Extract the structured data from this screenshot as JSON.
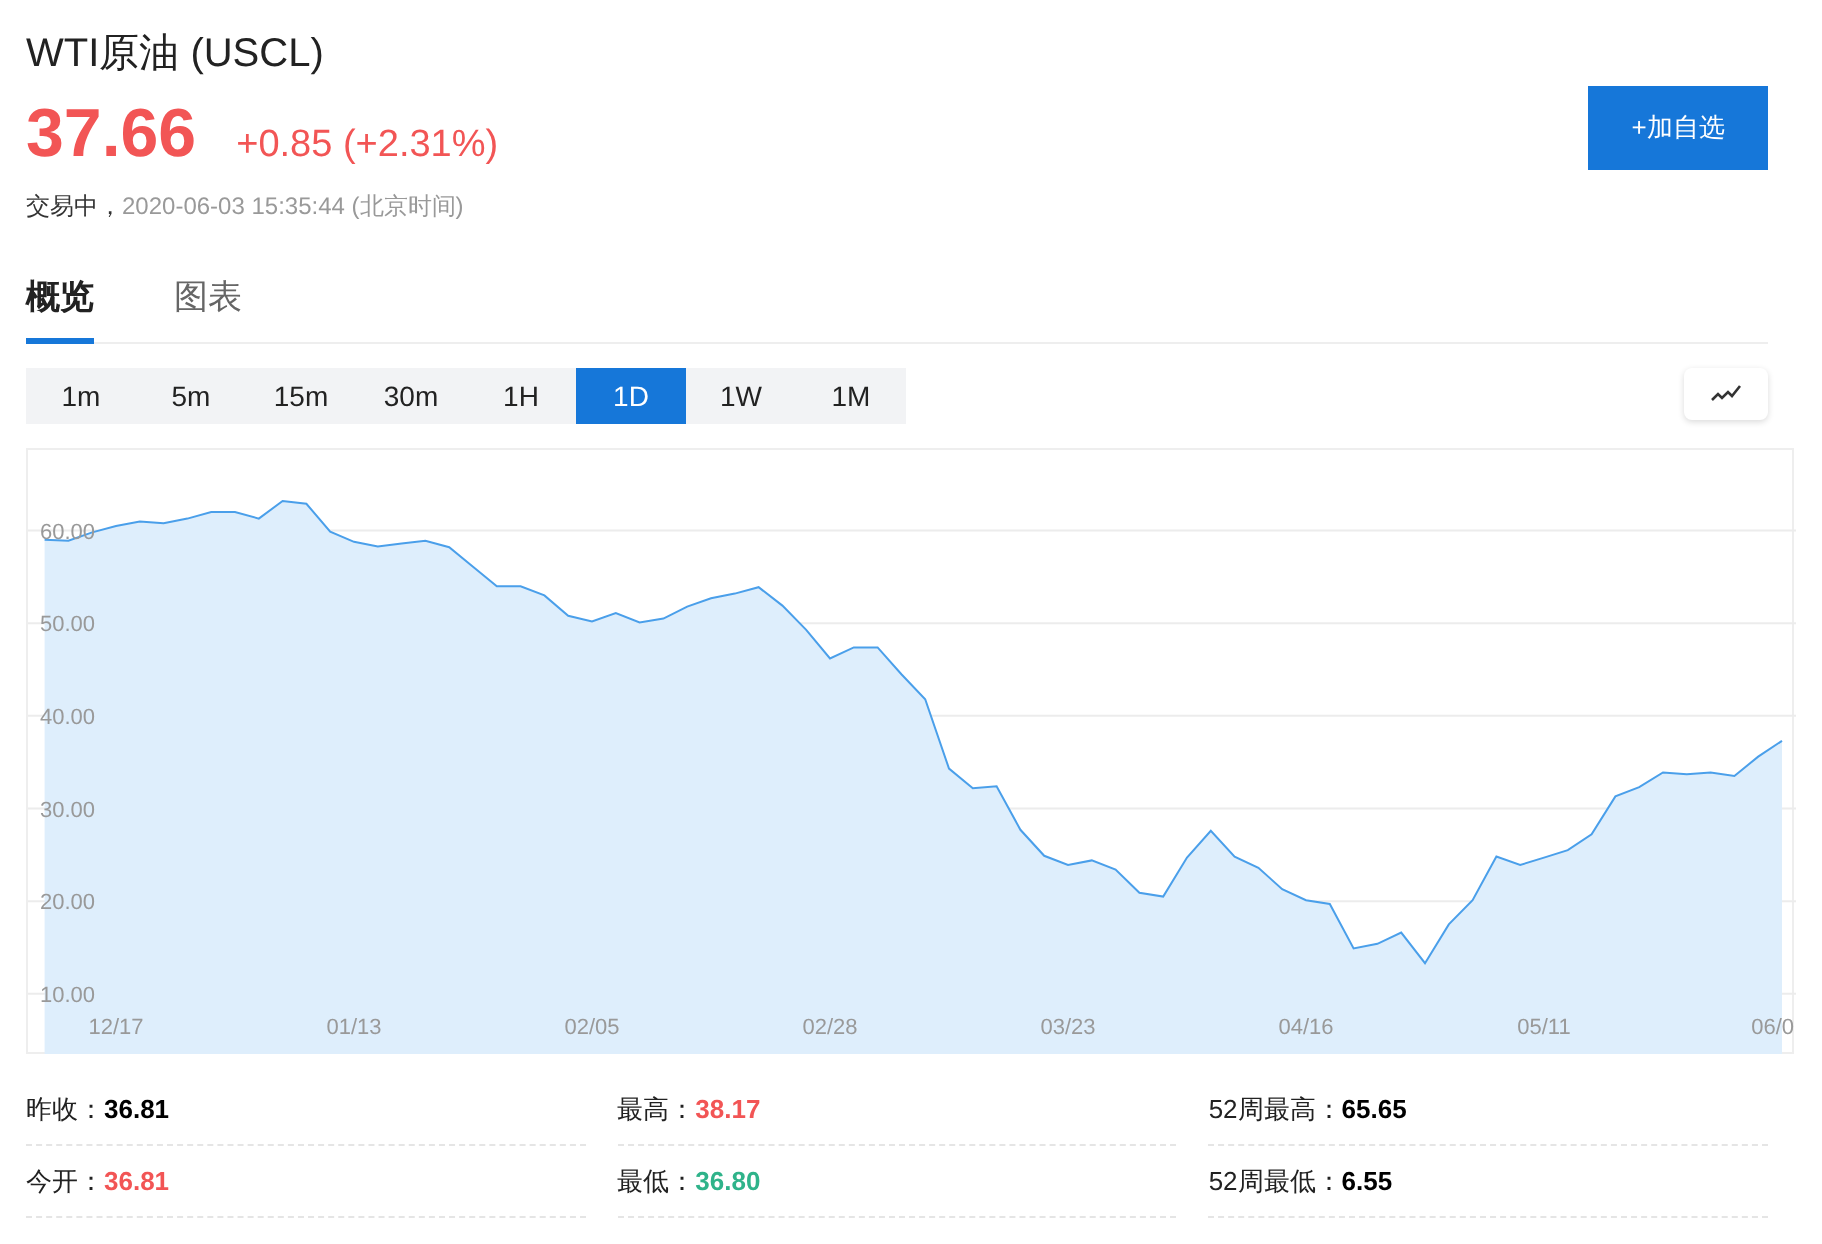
{
  "header": {
    "title": "WTI原油 (USCL)",
    "price": "37.66",
    "change": "+0.85 (+2.31%)",
    "status": "交易中，",
    "time": "2020-06-03 15:35:44 (北京时间)",
    "watchlist_button": "+加自选"
  },
  "tabs": [
    {
      "label": "概览",
      "selected": true
    },
    {
      "label": "图表",
      "selected": false
    }
  ],
  "periods": [
    {
      "label": "1m",
      "selected": false
    },
    {
      "label": "5m",
      "selected": false
    },
    {
      "label": "15m",
      "selected": false
    },
    {
      "label": "30m",
      "selected": false
    },
    {
      "label": "1H",
      "selected": false
    },
    {
      "label": "1D",
      "selected": true
    },
    {
      "label": "1W",
      "selected": false
    },
    {
      "label": "1M",
      "selected": false
    }
  ],
  "chart_data": {
    "type": "area",
    "grid": true,
    "ylim": [
      3.5,
      68.7
    ],
    "yticks": [
      {
        "value": 10,
        "label": "10.00"
      },
      {
        "value": 20,
        "label": "20.00"
      },
      {
        "value": 30,
        "label": "30.00"
      },
      {
        "value": 40,
        "label": "40.00"
      },
      {
        "value": 50,
        "label": "50.00"
      },
      {
        "value": 60,
        "label": "60.00"
      }
    ],
    "categories": [
      null,
      null,
      null,
      "12/17",
      null,
      null,
      null,
      null,
      null,
      null,
      null,
      null,
      null,
      "01/13",
      null,
      null,
      null,
      null,
      null,
      null,
      null,
      null,
      null,
      "02/05",
      null,
      null,
      null,
      null,
      null,
      null,
      null,
      null,
      null,
      "02/28",
      null,
      null,
      null,
      null,
      null,
      null,
      null,
      null,
      null,
      "03/23",
      null,
      null,
      null,
      null,
      null,
      null,
      null,
      null,
      null,
      "04/16",
      null,
      null,
      null,
      null,
      null,
      null,
      null,
      null,
      null,
      "05/11",
      null,
      null,
      null,
      null,
      null,
      null,
      null,
      null,
      null,
      "06/0"
    ],
    "series": [
      {
        "color": "#4a9fea",
        "values": [
          59.0,
          58.9,
          59.8,
          60.5,
          61.0,
          60.8,
          61.3,
          62,
          62,
          61.3,
          63.2,
          62.9,
          59.9,
          58.8,
          58.3,
          58.6,
          58.9,
          58.2,
          56.1,
          54.0,
          54.0,
          53.0,
          50.8,
          50.2,
          51.1,
          50.1,
          50.5,
          51.8,
          52.7,
          53.2,
          53.9,
          51.9,
          49.3,
          46.2,
          47.4,
          47.4,
          44.5,
          41.8,
          34.3,
          32.2,
          32.4,
          27.7,
          24.9,
          23.9,
          24.4,
          23.4,
          20.9,
          20.5,
          24.7,
          27.6,
          24.8,
          23.6,
          21.3,
          20.1,
          19.7,
          14.9,
          15.4,
          16.6,
          13.3,
          17.5,
          20.1,
          24.8,
          23.9,
          24.7,
          25.5,
          27.2,
          31.3,
          32.3,
          33.9,
          33.7,
          33.9,
          33.5,
          35.6,
          37.3
        ]
      }
    ]
  },
  "stats": [
    {
      "label": "昨收：",
      "value": "36.81",
      "color": "#000000"
    },
    {
      "label": "最高：",
      "value": "38.17",
      "color": "#f25555"
    },
    {
      "label": "52周最高：",
      "value": "65.65",
      "color": "#000000"
    },
    {
      "label": "今开：",
      "value": "36.81",
      "color": "#f25555"
    },
    {
      "label": "最低：",
      "value": "36.80",
      "color": "#2fb38a"
    },
    {
      "label": "52周最低：",
      "value": "6.55",
      "color": "#000000"
    }
  ]
}
